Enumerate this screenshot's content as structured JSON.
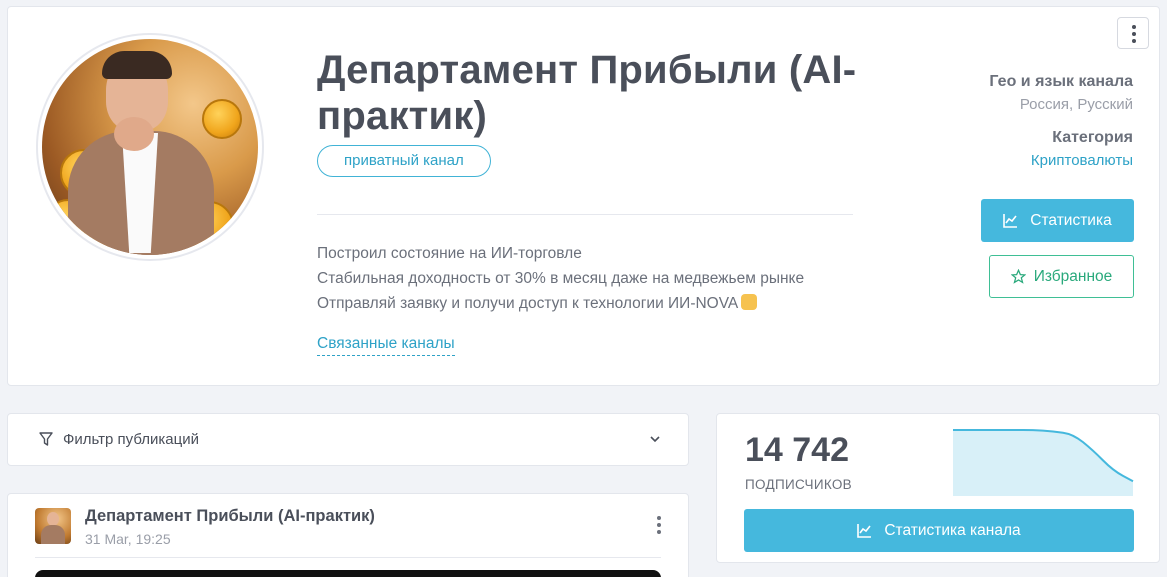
{
  "channel": {
    "title": "Департамент Прибыли (AI-практик)",
    "badge": "приватный канал",
    "description": [
      "Построил состояние на ИИ-торговле",
      "Стабильная доходность от 30% в месяц даже на медвежьем рынке",
      "Отправляй заявку и получи доступ к технологии ИИ-NOVA"
    ],
    "related_link": "Связанные каналы"
  },
  "meta": {
    "geo_label": "Гео и язык канала",
    "geo_value": "Россия, Русский",
    "category_label": "Категория",
    "category_value": "Криптовалюты"
  },
  "buttons": {
    "stats": "Статистика",
    "favorite": "Избранное",
    "channel_stats": "Статистика канала"
  },
  "filter": {
    "label": "Фильтр публикаций"
  },
  "post": {
    "author": "Департамент Прибыли (AI-практик)",
    "date": "31 Mar, 19:25"
  },
  "subscribers": {
    "count": "14 742",
    "label": "ПОДПИСЧИКОВ",
    "trend": [
      1.0,
      1.0,
      1.0,
      1.0,
      1.0,
      0.99,
      0.97,
      0.85,
      0.7,
      0.62
    ]
  },
  "colors": {
    "accent": "#45b8dd",
    "favorite": "#3fbf95",
    "link": "#2ea2c7"
  },
  "icons": {
    "menu": "vertical-dots-icon",
    "chart": "line-chart-icon",
    "star": "star-outline-icon",
    "filter": "funnel-icon",
    "chevron": "chevron-down-icon",
    "emoji": "pointing-down-hand-icon"
  }
}
